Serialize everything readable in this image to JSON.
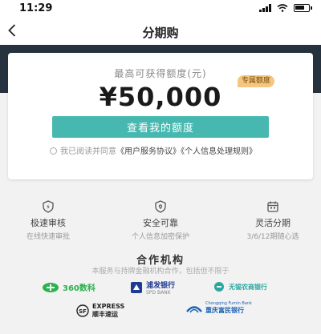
{
  "status_bar": {
    "time": "11:29"
  },
  "nav": {
    "title": "分期购"
  },
  "quota": {
    "label": "最高可获得额度(元)",
    "badge": "专属额度",
    "amount": "¥50,000",
    "button_label": "查看我的额度"
  },
  "agreement": {
    "prefix": "我已阅读并同意",
    "link_user": "《用户服务协议》",
    "link_privacy": "《个人信息处理规则》"
  },
  "features": [
    {
      "title": "极速审核",
      "desc": "在线快速审批",
      "icon": "shield-icon"
    },
    {
      "title": "安全可靠",
      "desc": "个人信息加密保护",
      "icon": "lock-icon"
    },
    {
      "title": "灵活分期",
      "desc": "3/6/12期随心选",
      "icon": "calendar-icon"
    }
  ],
  "partners": {
    "title": "合作机构",
    "desc": "本服务与持牌金融机构合作，包括但不限于",
    "logos": {
      "l360": "360数科",
      "spd_cn": "浦发银行",
      "spd_en": "SPD BANK",
      "xiamen": "无锡农商银行",
      "sf_en": "EXPRESS",
      "sf_cn": "顺丰速运",
      "cq_en": "Chongqing Fumin Bank",
      "cq_cn": "重庆富民银行"
    }
  },
  "colors": {
    "accent": "#47b8b0",
    "hero_bg": "#26333f",
    "badge_bg": "#f3c77f"
  }
}
